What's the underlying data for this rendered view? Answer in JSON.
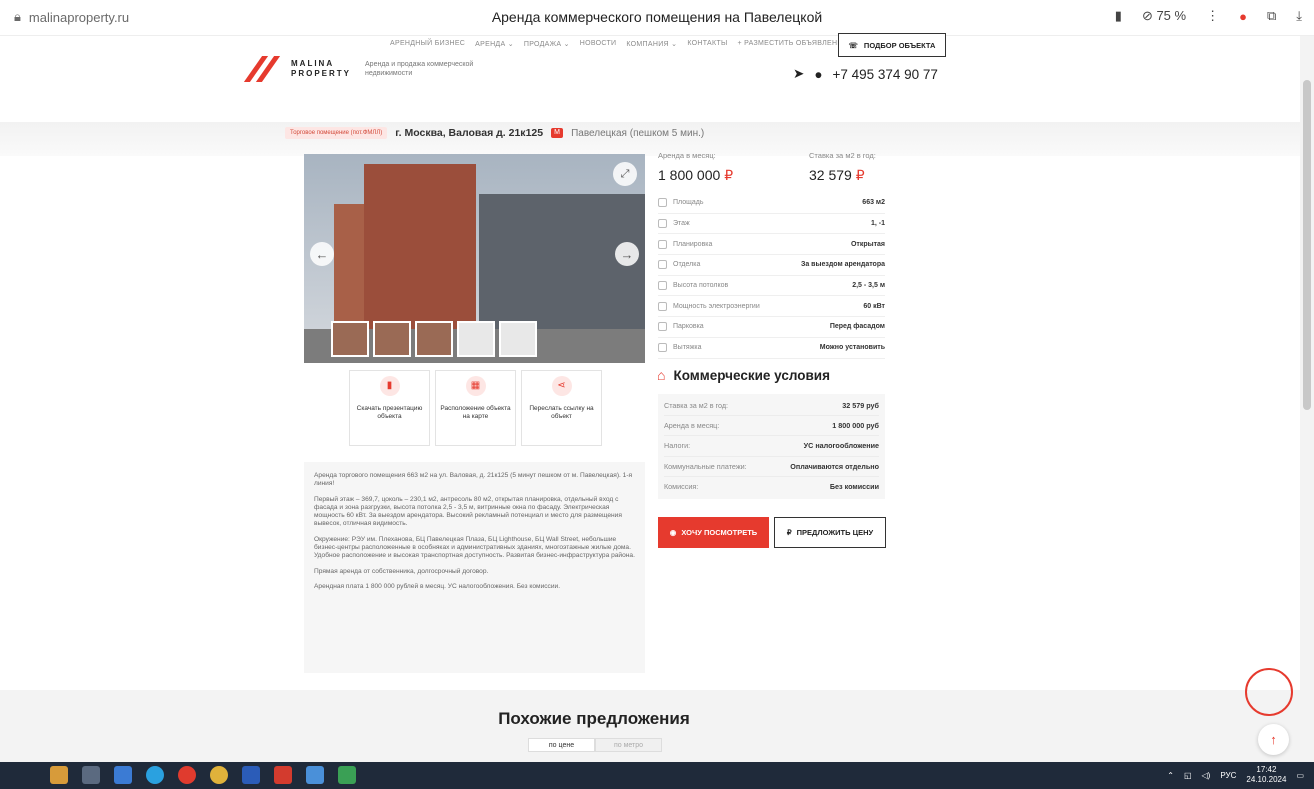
{
  "browser": {
    "url": "malinaproperty.ru",
    "title": "Аренда коммерческого помещения на Павелецкой",
    "zoom": "75 %"
  },
  "nav": {
    "items": [
      "Арендный бизнес",
      "Аренда ⌄",
      "Продажа ⌄",
      "Новости",
      "Компания ⌄",
      "Контакты",
      "+ Разместить объявление"
    ],
    "pick_button": "Подбор объекта"
  },
  "logo": {
    "line1": "MALINA",
    "line2": "PROPERTY",
    "tagline": "Аренда и продажа коммерческой недвижимости"
  },
  "contacts": {
    "phone": "+7 495 374 90 77"
  },
  "location": {
    "badge": "Торговое помещение (пот.ФМЛЛ)",
    "address": "г. Москва, Валовая д. 21к125",
    "metro_icon": "М",
    "metro": "Павелецкая (пешком 5 мин.)"
  },
  "price": {
    "monthly_label": "Аренда в месяц:",
    "monthly_value": "1 800 000",
    "per_m2_label": "Ставка за м2 в год:",
    "per_m2_value": "32 579",
    "currency": "₽"
  },
  "specs": [
    {
      "k": "Площадь",
      "v": "663 м2"
    },
    {
      "k": "Этаж",
      "v": "1, -1"
    },
    {
      "k": "Планировка",
      "v": "Открытая"
    },
    {
      "k": "Отделка",
      "v": "За выездом арендатора"
    },
    {
      "k": "Высота потолков",
      "v": "2,5 - 3,5 м"
    },
    {
      "k": "Мощность электроэнергии",
      "v": "60 кВт"
    },
    {
      "k": "Парковка",
      "v": "Перед фасадом"
    },
    {
      "k": "Вытяжка",
      "v": "Можно установить"
    }
  ],
  "conditions": {
    "title": "Коммерческие условия",
    "rows": [
      {
        "k": "Ставка за м2 в год:",
        "v": "32 579 руб"
      },
      {
        "k": "Аренда в месяц:",
        "v": "1 800 000 руб"
      },
      {
        "k": "Налоги:",
        "v": "УС налогообложение"
      },
      {
        "k": "Коммунальные платежи:",
        "v": "Оплачиваются отдельно"
      },
      {
        "k": "Комиссия:",
        "v": "Без комиссии"
      }
    ]
  },
  "actions": [
    {
      "label": "Скачать презентацию объекта"
    },
    {
      "label": "Расположение объекта на карте"
    },
    {
      "label": "Переслать ссылку на объект"
    }
  ],
  "description": [
    "Аренда торгового помещения 663 м2 на ул. Валовая, д. 21к125 (5 минут пешком от м. Павелецкая). 1-я линия!",
    "Первый этаж – 369,7, цоколь – 230,1 м2, антресоль 80 м2, открытая планировка, отдельный вход с фасада и зона разгрузки, высота потолка 2,5 - 3,5 м, витринные окна по фасаду. Электрическая мощность 60 кВт. За выездом арендатора. Высокий рекламный потенциал и место для размещения вывесок, отличная видимость.",
    "Окружение: РЭУ им. Плеханова, БЦ Павелецкая Плаза, БЦ Lighthouse, БЦ Wall Street, небольшие бизнес-центры расположенные в особняках и административных зданиях, многоэтажные жилые дома. Удобное расположение и высокая транспортная доступность. Развитая бизнес-инфраструктура района.",
    "Прямая аренда от собственника, долгосрочный договор.",
    "Арендная плата 1 800 000 рублей в месяц. УС налогообложения. Без комиссии."
  ],
  "buttons": {
    "want_see": "Хочу посмотреть",
    "offer_price": "Предложить цену"
  },
  "similar": {
    "title": "Похожие предложения",
    "tab_price": "по цене",
    "tab_metro": "по метро"
  },
  "taskbar": {
    "lang": "РУС",
    "time": "17:42",
    "date": "24.10.2024"
  },
  "colors": {
    "accent": "#e63a2e",
    "taskbar": "#1f2a3a"
  }
}
